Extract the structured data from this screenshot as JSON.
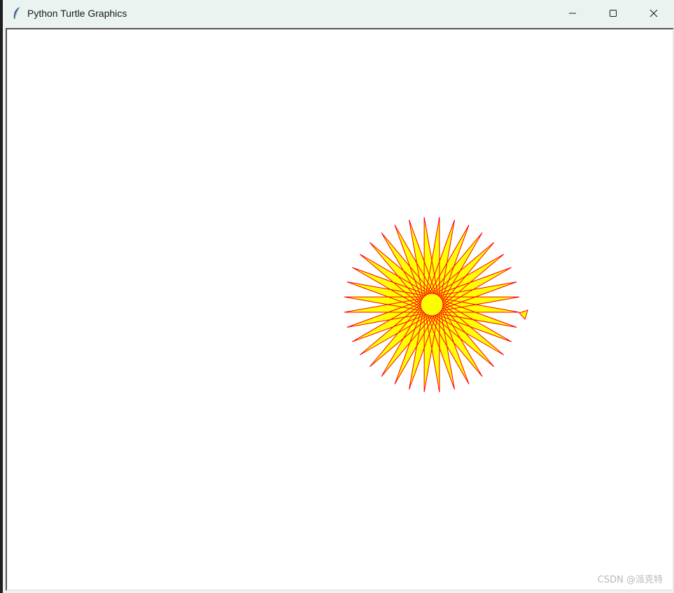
{
  "window": {
    "title": "Python Turtle Graphics"
  },
  "controls": {
    "minimize_icon": "minimize-icon",
    "maximize_icon": "maximize-icon",
    "close_icon": "close-icon"
  },
  "drawing": {
    "shape": "star",
    "points": 36,
    "fill_color": "#ffff00",
    "pen_color": "#ff0000",
    "background": "#ffffff"
  },
  "watermark": "CSDN @派克特"
}
